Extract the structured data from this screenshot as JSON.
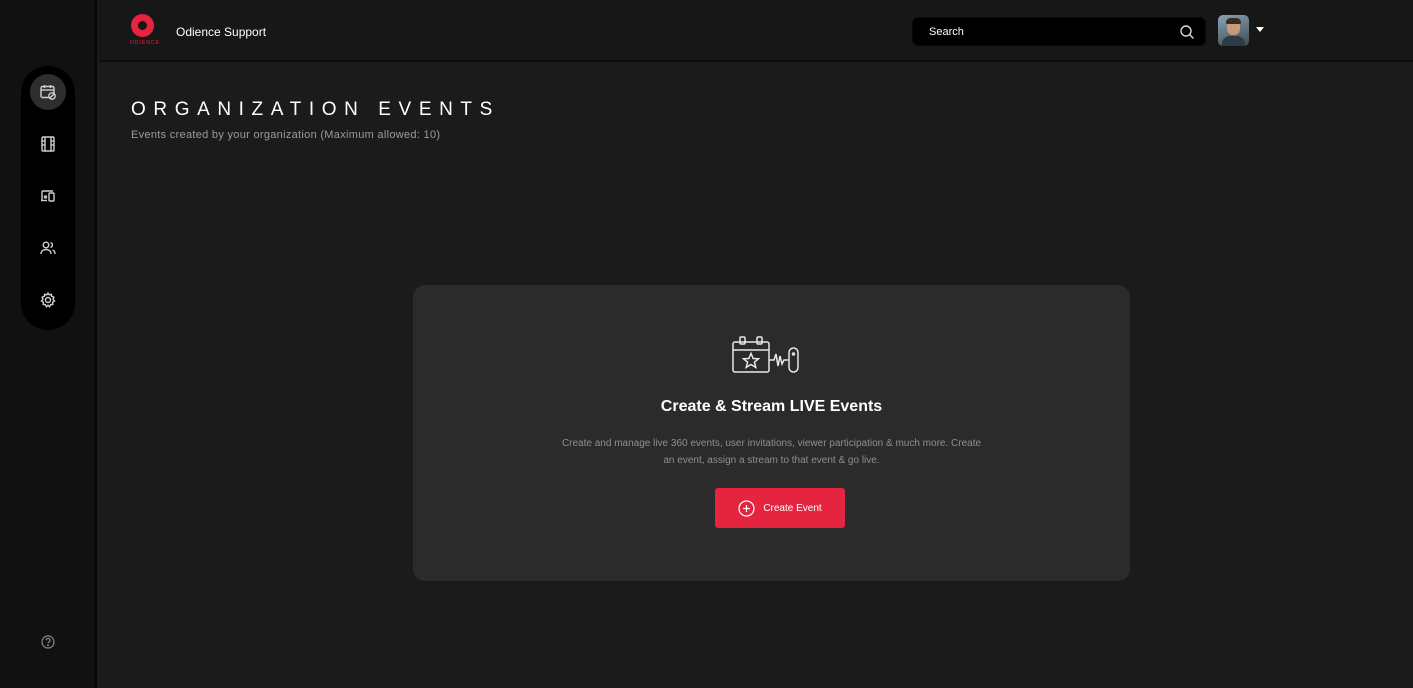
{
  "header": {
    "org_name": "Odience Support",
    "logo_word": "ODIENCE",
    "search": {
      "placeholder": "Search",
      "value": ""
    }
  },
  "sidebar": {
    "items": [
      {
        "id": "events",
        "icon": "calendar-check-icon",
        "active": true
      },
      {
        "id": "media",
        "icon": "film-icon",
        "active": false
      },
      {
        "id": "devices",
        "icon": "devices-icon",
        "active": false
      },
      {
        "id": "users",
        "icon": "users-icon",
        "active": false
      },
      {
        "id": "settings",
        "icon": "gear-icon",
        "active": false
      }
    ],
    "help_icon": "help-icon"
  },
  "page": {
    "title": "ORGANIZATION EVENTS",
    "subtitle": "Events created by your organization (Maximum allowed: 10)"
  },
  "empty_state": {
    "illustration": "event-stream-icon",
    "title": "Create & Stream LIVE Events",
    "description": "Create and manage live 360 events, user invitations, viewer participation & much more. Create an event, assign a stream to that event & go live.",
    "button_label": "Create Event"
  },
  "colors": {
    "accent": "#e52440",
    "background": "#1b1b1b",
    "card": "#2b2b2b",
    "rail": "#111111"
  }
}
